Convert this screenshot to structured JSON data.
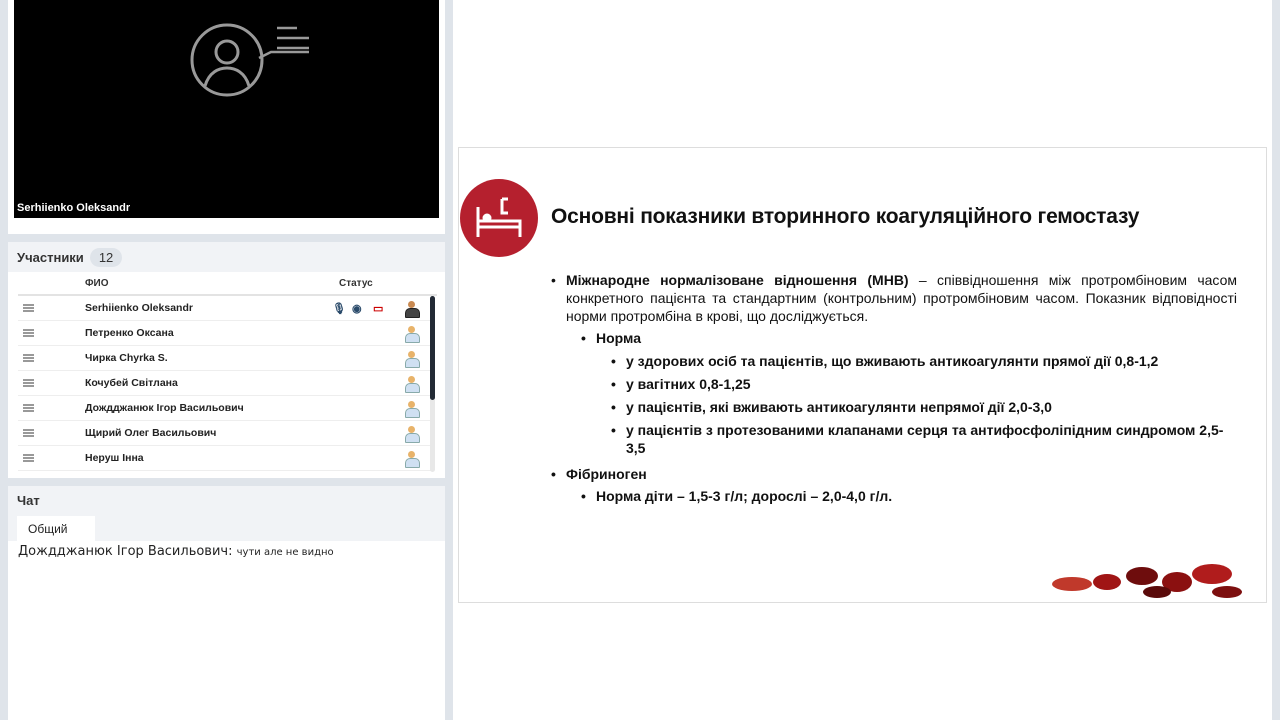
{
  "video": {
    "name": "Serhiienko Oleksandr"
  },
  "participants": {
    "title": "Участники",
    "count": "12",
    "col_name": "ФИО",
    "col_status": "Статус",
    "rows": [
      {
        "name": "Serhiienko Oleksandr"
      },
      {
        "name": "Петренко Оксана"
      },
      {
        "name": "Чирка Chyrka S."
      },
      {
        "name": "Кочубей Світлана"
      },
      {
        "name": "Дождджанюк Ігор  Васильович"
      },
      {
        "name": "Щирий Олег Васильович"
      },
      {
        "name": "Неруш Інна"
      }
    ]
  },
  "chat": {
    "title": "Чат",
    "tab": "Общий",
    "messages": [
      {
        "author": "Дождджанюк Ігор  Васильович:",
        "text": "чути але не видно"
      }
    ]
  },
  "slide": {
    "title": "Основні показники вторинного коагуляційного гемостазу",
    "inr_term": "Міжнародне нормалізоване відношення (МНВ)",
    "inr_def": " – співвідношення між протромбіновим часом конкретного пацієнта та стандартним (контрольним) протромбіновим часом. Показник відповідності норми протромбіна в крові, що досліджується.",
    "norm_label": "Норма",
    "norms": [
      "у здорових осіб та пацієнтів, що вживають антикоагулянти прямої дії 0,8-1,2",
      "у вагітних 0,8-1,25",
      "у пацієнтів, які вживають антикоагулянти непрямої дії 2,0-3,0",
      "у пацієнтів з протезованими клапанами серця та антифосфоліпідним синдромом 2,5-3,5"
    ],
    "fib_label": "Фібриноген",
    "fib_norm": "Норма діти – 1,5-3 г/л; дорослі – 2,0-4,0 г/л."
  },
  "colors": {
    "accent": "#b5202e"
  }
}
